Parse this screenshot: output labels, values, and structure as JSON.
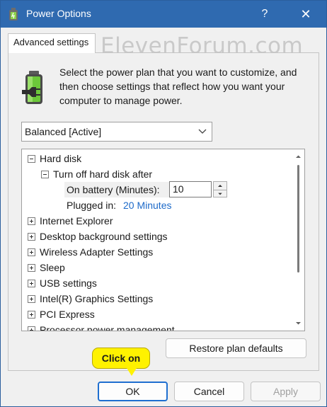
{
  "window": {
    "title": "Power Options",
    "help_label": "?",
    "close_label": "✕"
  },
  "tab": {
    "label": "Advanced settings"
  },
  "watermark": "ElevenForum.com",
  "intro": "Select the power plan that you want to customize, and then choose settings that reflect how you want your computer to manage power.",
  "plan_select": {
    "value": "Balanced [Active]"
  },
  "tree": {
    "hard_disk": "Hard disk",
    "turn_off": "Turn off hard disk after",
    "on_battery_label": "On battery (Minutes):",
    "on_battery_value": "10",
    "plugged_in_label": "Plugged in:",
    "plugged_in_value": "20 Minutes",
    "items": [
      "Internet Explorer",
      "Desktop background settings",
      "Wireless Adapter Settings",
      "Sleep",
      "USB settings",
      "Intel(R) Graphics Settings",
      "PCI Express",
      "Processor power management"
    ]
  },
  "buttons": {
    "restore": "Restore plan defaults",
    "ok": "OK",
    "cancel": "Cancel",
    "apply": "Apply"
  },
  "callout": "Click on",
  "colors": {
    "titlebar": "#2f6ab0",
    "link": "#1d6ac9",
    "callout": "#fff200",
    "ok_border": "#1f6fd0"
  }
}
